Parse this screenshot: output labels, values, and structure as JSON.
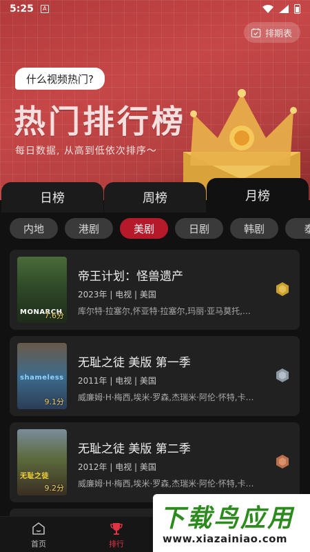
{
  "status": {
    "time": "5:25",
    "notif": "A"
  },
  "header": {
    "schedule_label": "排期表",
    "bubble": "什么视频热门?",
    "title": "热门排行榜",
    "subtitle": "每日数据, 从高到低依次排序～"
  },
  "tabs": [
    {
      "label": "日榜",
      "active": false
    },
    {
      "label": "周榜",
      "active": false
    },
    {
      "label": "月榜",
      "active": true
    }
  ],
  "chips": [
    {
      "label": "内地",
      "active": false
    },
    {
      "label": "港剧",
      "active": false
    },
    {
      "label": "美剧",
      "active": true
    },
    {
      "label": "日剧",
      "active": false
    },
    {
      "label": "韩剧",
      "active": false
    },
    {
      "label": "泰",
      "active": false
    }
  ],
  "cards": [
    {
      "title": "帝王计划：怪兽遗产",
      "meta": "2023年 | 电视 | 美国",
      "cast": "库尔特·拉塞尔,怀亚特·拉塞尔,玛丽·亚马莫托,泽...",
      "score": "7.6分",
      "poster_text": "MONARCH",
      "rank_color": "#c9a02e"
    },
    {
      "title": "无耻之徒 美版 第一季",
      "meta": "2011年 | 电视 | 美国",
      "cast": "威廉姆·H·梅西,埃米·罗森,杰瑞米·阿伦·怀特,卡梅...",
      "score": "9.1分",
      "poster_text": "shameless",
      "rank_color": "#9aa3ae"
    },
    {
      "title": "无耻之徒 美版 第二季",
      "meta": "2012年 | 电视 | 美国",
      "cast": "威廉姆·H·梅西,埃米·罗森,杰瑞米·阿伦·怀特,卡梅...",
      "score": "9.2分",
      "poster_text": "无耻之徒",
      "rank_color": "#c47b55"
    }
  ],
  "nav": [
    {
      "label": "首页",
      "icon": "home-icon"
    },
    {
      "label": "排行",
      "icon": "trophy-icon"
    }
  ],
  "watermark": {
    "brand": "下载鸟应用",
    "url": "www.xiazainiao.com"
  },
  "colors": {
    "accent": "#b51a2a",
    "hero": "#c64747",
    "card": "#212121"
  }
}
